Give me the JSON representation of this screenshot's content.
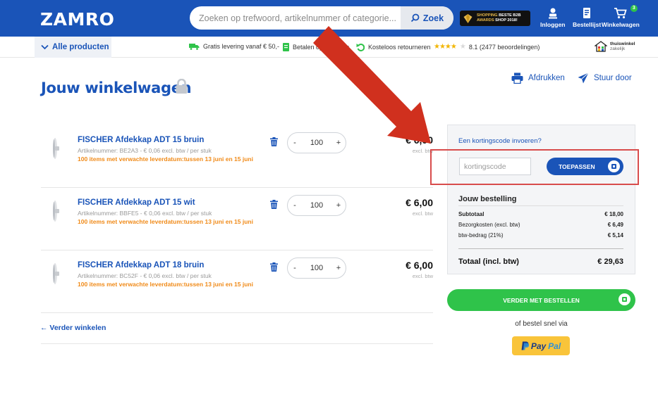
{
  "header": {
    "logo": "ZAMRO",
    "search_placeholder": "Zoeken op trefwoord, artikelnummer of categorie...",
    "search_button": "Zoek",
    "award_line1": "SHOPPING",
    "award_line1b": "BESTE B2B",
    "award_line2": "AWARDS",
    "award_line2b": "SHOP 2018!",
    "login_label": "Inloggen",
    "list_label": "Bestellijst",
    "cart_label": "Winkelwagen",
    "cart_count": "3",
    "brand_color": "#1a54b8"
  },
  "subbar": {
    "all_products": "Alle producten",
    "usp_shipping": "Gratis levering vanaf € 50,-",
    "usp_invoice": "Betalen op rekening",
    "usp_returns": "Kosteloos retourneren",
    "rating_stars": 4,
    "rating_text": "8.1 (2477 beoordelingen)",
    "thuiswinkel": "thuiswinkel",
    "thuiswinkel_sub": "zakelijk"
  },
  "page": {
    "title": "Jouw winkelwagen",
    "print_label": "Afdrukken",
    "send_label": "Stuur door",
    "continue_label": "← Verder winkelen"
  },
  "items": [
    {
      "name": "FISCHER Afdekkap ADT 15 bruin",
      "meta": "Artikelnummer:  BE2A3  -  € 0,06 excl. btw  / per stuk",
      "delivery": "100 items met verwachte leverdatum:tussen 13 juni en 15 juni",
      "quantity": "100",
      "price": "€ 6,00",
      "price_note": "excl. btw"
    },
    {
      "name": "FISCHER Afdekkap ADT 15 wit",
      "meta": "Artikelnummer:  BBFE5  -  € 0,06 excl. btw  / per stuk",
      "delivery": "100 items met verwachte leverdatum:tussen 13 juni en 15 juni",
      "quantity": "100",
      "price": "€ 6,00",
      "price_note": "excl. btw"
    },
    {
      "name": "FISCHER Afdekkap ADT 18 bruin",
      "meta": "Artikelnummer:  BC52F  -  € 0,06 excl. btw  / per stuk",
      "delivery": "100 items met verwachte leverdatum:tussen 13 juni en 15 juni",
      "quantity": "100",
      "price": "€ 6,00",
      "price_note": "excl. btw"
    }
  ],
  "summary": {
    "coupon_link": "Een kortingscode invoeren?",
    "coupon_placeholder": "kortingscode",
    "apply_button": "TOEPASSEN",
    "order_title": "Jouw bestelling",
    "subtotal_label": "Subtotaal",
    "subtotal_value": "€ 18,00",
    "shipping_label": "Bezorgkosten (excl. btw)",
    "shipping_value": "€ 6,49",
    "vat_label": "btw-bedrag (21%)",
    "vat_value": "€ 5,14",
    "total_label": "Totaal (incl. btw)",
    "total_value": "€ 29,63",
    "checkout_button": "VERDER MET BESTELLEN",
    "fast_checkout": "of bestel snel via",
    "paypal_pay": "Pay",
    "paypal_pal": "Pal"
  },
  "colors": {
    "annotation_red": "#d0301e",
    "checkout_green": "#2fc34a",
    "delivery_orange": "#f08a18"
  }
}
